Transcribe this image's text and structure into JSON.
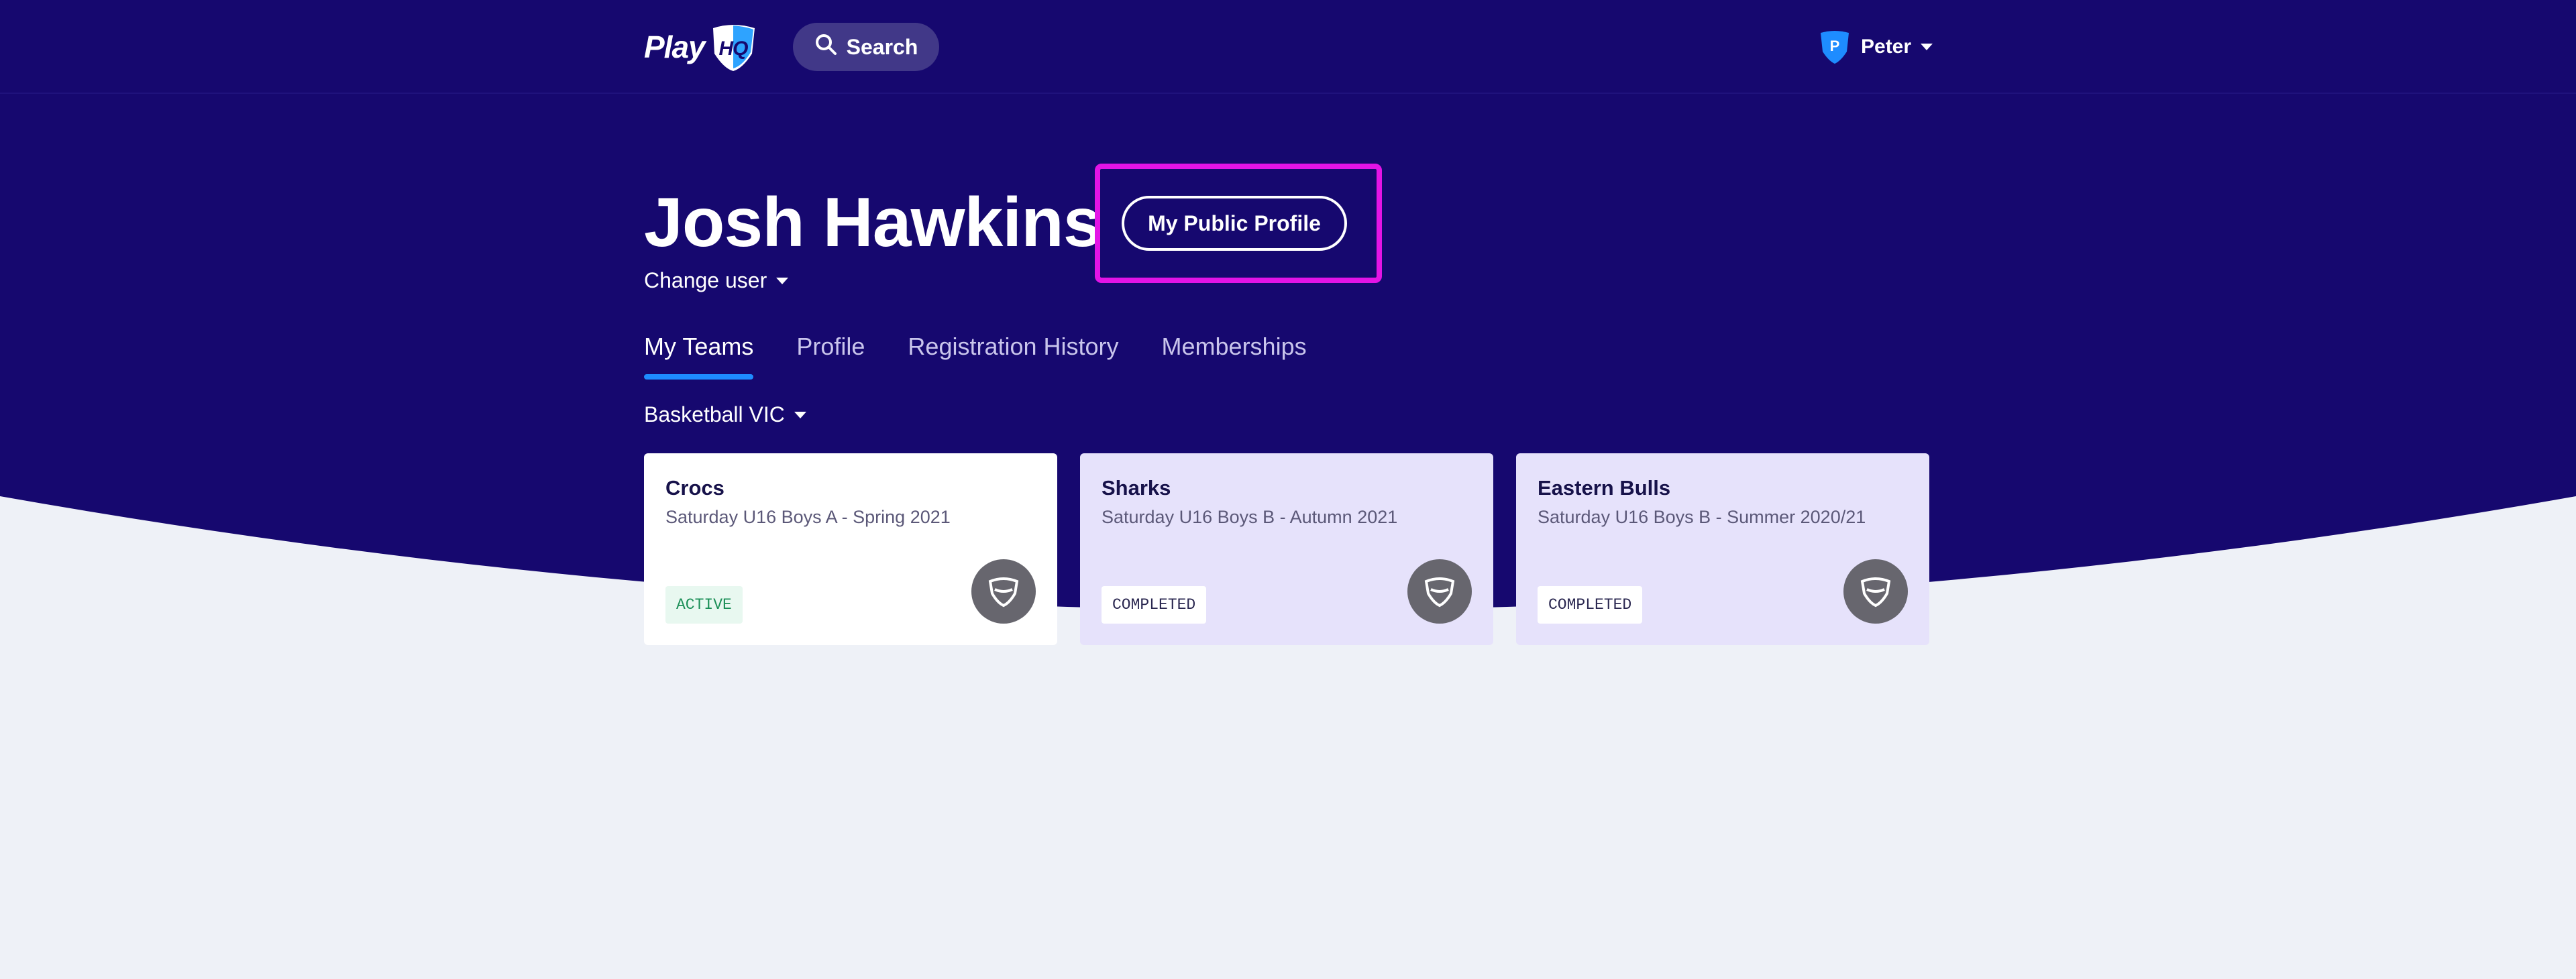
{
  "header": {
    "logo_text": "Play",
    "logo_badge": "HQ",
    "search_label": "Search",
    "user_initial": "P",
    "user_name": "Peter"
  },
  "profile": {
    "name": "Josh Hawkins",
    "public_profile_button": "My Public Profile",
    "change_user_label": "Change user"
  },
  "tabs": [
    {
      "label": "My Teams",
      "active": true
    },
    {
      "label": "Profile",
      "active": false
    },
    {
      "label": "Registration History",
      "active": false
    },
    {
      "label": "Memberships",
      "active": false
    }
  ],
  "organisation_filter": "Basketball VIC",
  "teams": [
    {
      "name": "Crocs",
      "competition": "Saturday U16 Boys A - Spring 2021",
      "status": "ACTIVE"
    },
    {
      "name": "Sharks",
      "competition": "Saturday U16 Boys B - Autumn 2021",
      "status": "COMPLETED"
    },
    {
      "name": "Eastern Bulls",
      "competition": "Saturday U16 Boys B - Summer 2020/21",
      "status": "COMPLETED"
    }
  ],
  "colors": {
    "brand_navy": "#16086f",
    "tab_underline": "#1e8cff",
    "highlight_magenta": "#e314e6",
    "page_background": "#eef1f7",
    "active_green": "#1b8f57"
  }
}
